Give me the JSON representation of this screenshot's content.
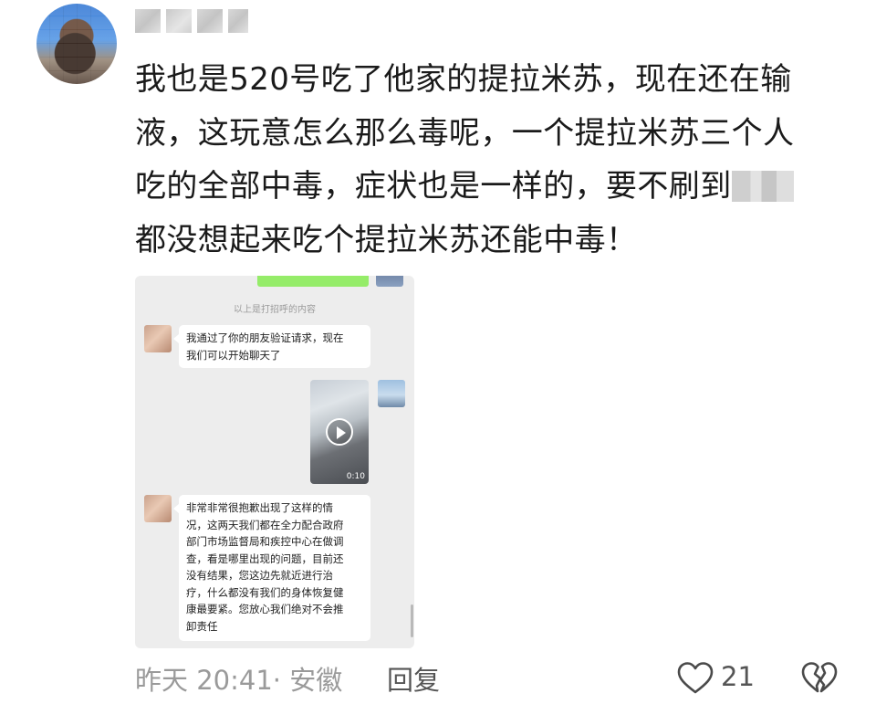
{
  "comment": {
    "lines": [
      "我也是520号吃了他家的提拉米苏，现在还在输",
      "液，这玩意怎么那么毒呢，一个提拉米苏三个人",
      "吃的全部中毒，症状也是一样的，要不刷到",
      "都没想起来吃个提拉米苏还能中毒！"
    ]
  },
  "screenshot": {
    "system_note": "以上是打招呼的内容",
    "message_1": [
      "我通过了你的朋友验证请求，现在",
      "我们可以开始聊天了"
    ],
    "video_duration": "0:10",
    "message_2": [
      "非常非常很抱歉出现了这样的情",
      "况，这两天我们都在全力配合政府",
      "部门市场监督局和疾控中心在做调",
      "查，看是哪里出现的问题，目前还",
      "没有结果，您这边先就近进行治",
      "疗，什么都没有我们的身体恢复健",
      "康最要紧。您放心我们绝对不会推",
      "卸责任"
    ]
  },
  "footer": {
    "meta": "昨天 20:41· 安徽",
    "reply_label": "回复",
    "like_count": "21"
  },
  "icons": {
    "like": "heart-outline-icon",
    "dislike": "broken-heart-icon"
  }
}
